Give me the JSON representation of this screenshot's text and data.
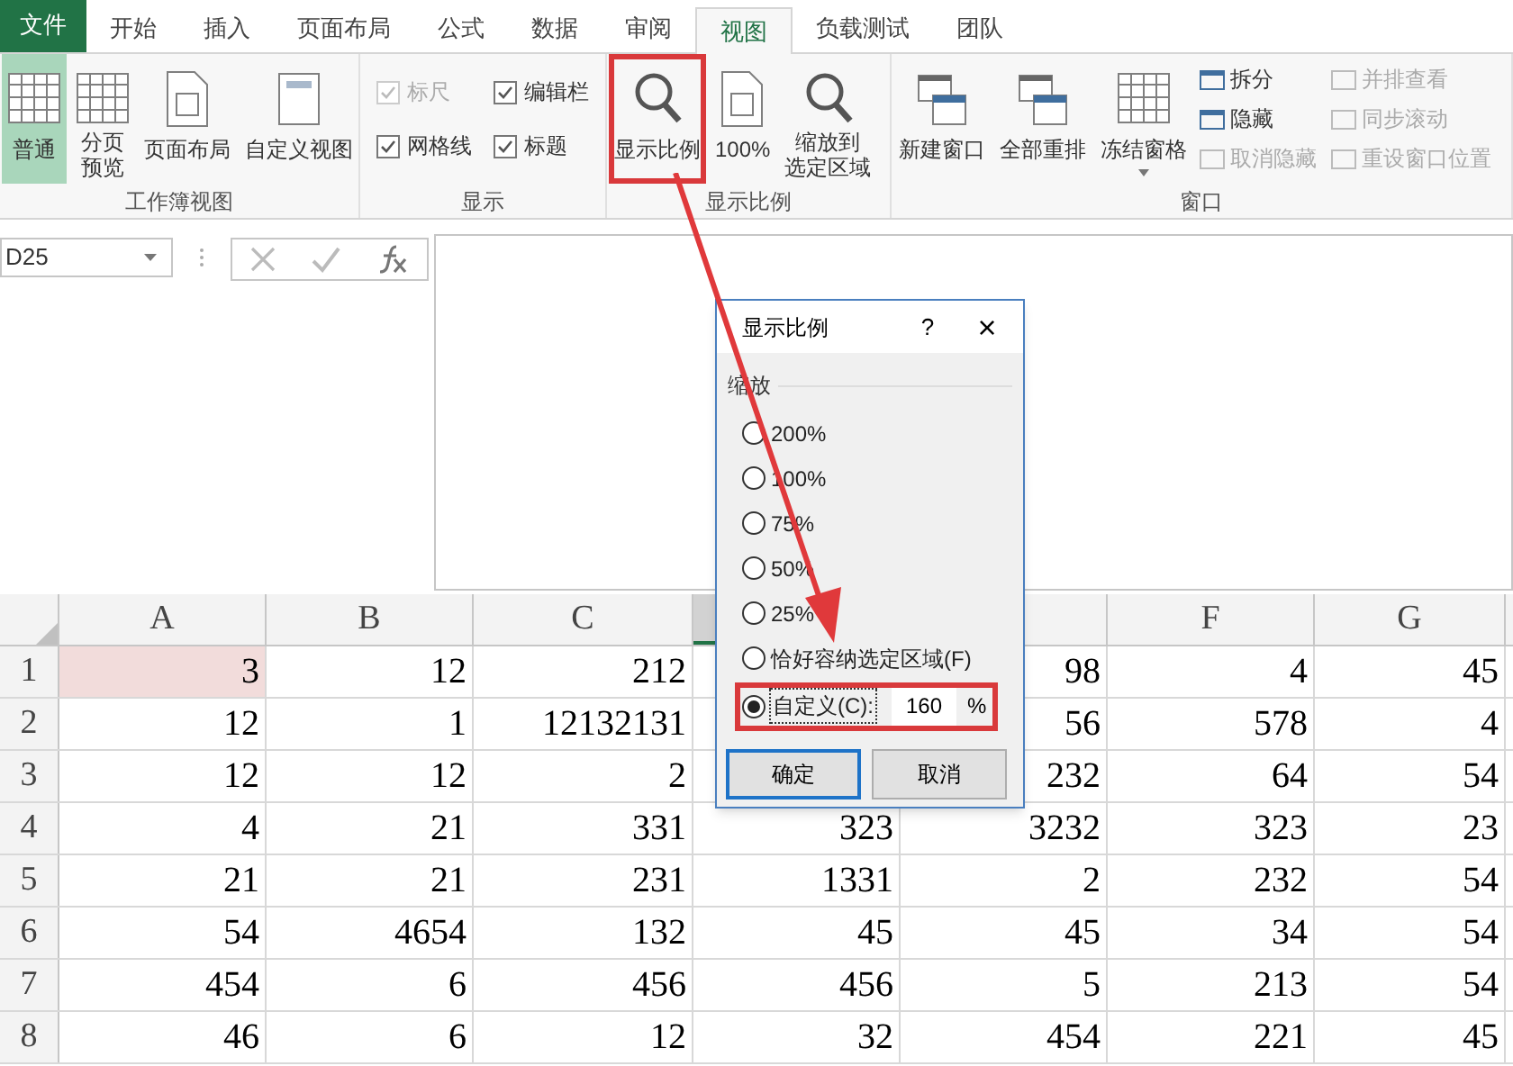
{
  "tabs": [
    {
      "label": "文件",
      "kind": "file",
      "selected": false
    },
    {
      "label": "开始",
      "kind": "tab",
      "selected": false
    },
    {
      "label": "插入",
      "kind": "tab",
      "selected": false
    },
    {
      "label": "页面布局",
      "kind": "tab",
      "selected": false
    },
    {
      "label": "公式",
      "kind": "tab",
      "selected": false
    },
    {
      "label": "数据",
      "kind": "tab",
      "selected": false
    },
    {
      "label": "审阅",
      "kind": "tab",
      "selected": false
    },
    {
      "label": "视图",
      "kind": "tab",
      "selected": true
    },
    {
      "label": "负载测试",
      "kind": "tab",
      "selected": false
    },
    {
      "label": "团队",
      "kind": "tab",
      "selected": false
    }
  ],
  "ribbon": [
    {
      "label": "工作簿视图",
      "items": [
        {
          "kind": "big",
          "label": "普通",
          "selected": true
        },
        {
          "kind": "big",
          "lines": [
            "分页",
            "预览"
          ],
          "selected": false
        },
        {
          "kind": "big",
          "label": "页面布局",
          "selected": false
        },
        {
          "kind": "big",
          "label": "自定义视图",
          "selected": false
        }
      ]
    },
    {
      "label": "显示",
      "items": [
        {
          "kind": "check",
          "label": "标尺",
          "checked": true,
          "disabled": true
        },
        {
          "kind": "check",
          "label": "编辑栏",
          "checked": true,
          "disabled": false
        },
        {
          "kind": "check",
          "label": "网格线",
          "checked": true,
          "disabled": false
        },
        {
          "kind": "check",
          "label": "标题",
          "checked": true,
          "disabled": false
        }
      ]
    },
    {
      "label": "显示比例",
      "items": [
        {
          "kind": "big",
          "label": "显示比例",
          "selected": false,
          "annotated": true
        },
        {
          "kind": "big",
          "label": "100%",
          "selected": false
        },
        {
          "kind": "big",
          "lines": [
            "缩放到",
            "选定区域"
          ],
          "selected": false
        }
      ]
    },
    {
      "label": "窗口",
      "items": [
        {
          "kind": "big",
          "label": "新建窗口",
          "selected": false
        },
        {
          "kind": "big",
          "label": "全部重排",
          "selected": false
        },
        {
          "kind": "big",
          "label": "冻结窗格",
          "selected": false,
          "dropdown": true
        },
        {
          "kind": "small",
          "label": "拆分",
          "disabled": false
        },
        {
          "kind": "small",
          "label": "隐藏",
          "disabled": false
        },
        {
          "kind": "small",
          "label": "取消隐藏",
          "disabled": true
        },
        {
          "kind": "small",
          "label": "并排查看",
          "disabled": true
        },
        {
          "kind": "small",
          "label": "同步滚动",
          "disabled": true
        },
        {
          "kind": "small",
          "label": "重设窗口位置",
          "disabled": true
        }
      ]
    }
  ],
  "formula_bar": {
    "name_box": "D25"
  },
  "grid": {
    "columns": [
      {
        "label": "A",
        "selected": false
      },
      {
        "label": "B",
        "selected": false
      },
      {
        "label": "C",
        "selected": false
      },
      {
        "selected": true
      },
      {
        "selected": false
      },
      {
        "label": "F",
        "selected": false
      },
      {
        "label": "G",
        "selected": false
      }
    ],
    "rows": [
      {
        "label": "1",
        "cells": [
          {
            "value": "3",
            "highlighted": true
          },
          "12",
          "212",
          null,
          "98",
          "4",
          "45"
        ]
      },
      {
        "label": "2",
        "cells": [
          "12",
          "1",
          "12132131",
          null,
          "56",
          "578",
          "4"
        ]
      },
      {
        "label": "3",
        "cells": [
          "12",
          "12",
          "2",
          null,
          "232",
          "64",
          "54"
        ]
      },
      {
        "label": "4",
        "cells": [
          "4",
          "21",
          "331",
          "323",
          "3232",
          "323",
          "23"
        ]
      },
      {
        "label": "5",
        "cells": [
          "21",
          "21",
          "231",
          "1331",
          "2",
          "232",
          "54"
        ]
      },
      {
        "label": "6",
        "cells": [
          "54",
          "4654",
          "132",
          "45",
          "45",
          "34",
          "54"
        ]
      },
      {
        "label": "7",
        "cells": [
          "454",
          "6",
          "456",
          "456",
          "5",
          "213",
          "54"
        ]
      },
      {
        "label": "8",
        "cells": [
          "46",
          "6",
          "12",
          "32",
          "454",
          "221",
          "45"
        ]
      }
    ]
  },
  "dialog": {
    "title": "显示比例",
    "help": "?",
    "close": "×",
    "section": "缩放",
    "options": [
      {
        "label": "200%",
        "selected": false
      },
      {
        "label": "100%",
        "selected": false
      },
      {
        "label": "75%",
        "selected": false
      },
      {
        "label": "50%",
        "selected": false
      },
      {
        "label": "25%",
        "selected": false
      },
      {
        "label": "恰好容纳选定区域(F)",
        "selected": false
      },
      {
        "label": "自定义(C):",
        "selected": true,
        "kind": "custom",
        "value": "160",
        "unit": "%"
      }
    ],
    "buttons": [
      {
        "label": "确定",
        "default": true
      },
      {
        "label": "取消",
        "default": false
      }
    ]
  }
}
